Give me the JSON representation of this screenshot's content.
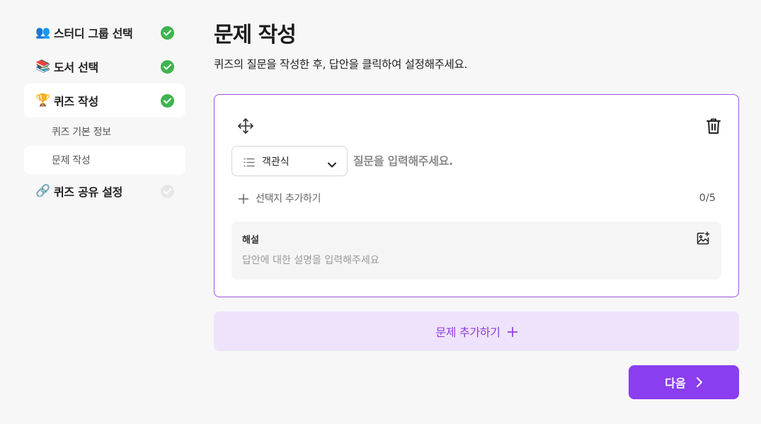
{
  "sidebar": {
    "steps": [
      {
        "emoji": "👥",
        "label": "스터디 그룹 선택",
        "done": true
      },
      {
        "emoji": "📚",
        "label": "도서 선택",
        "done": true
      },
      {
        "emoji": "🏆",
        "label": "퀴즈 작성",
        "done": true
      },
      {
        "emoji": "🔗",
        "label": "퀴즈 공유 설정",
        "done": false
      }
    ],
    "substeps": [
      {
        "label": "퀴즈 기본 정보"
      },
      {
        "label": "문제 작성"
      }
    ]
  },
  "main": {
    "title": "문제 작성",
    "description": "퀴즈의 질문을 작성한 후, 답안을 클릭하여 설정해주세요.",
    "question_card": {
      "type_select": {
        "value": "객관식",
        "icon": "list-icon"
      },
      "question_placeholder": "질문을 입력해주세요.",
      "add_choice_label": "선택지 추가하기",
      "choice_count": "0/5",
      "explanation": {
        "title": "해설",
        "placeholder": "답안에 대한 설명을 입력해주세요"
      }
    },
    "add_question_label": "문제 추가하기",
    "next_label": "다음"
  },
  "colors": {
    "accent": "#8a3ef0",
    "accent_light": "#efe3fb",
    "card_border": "#9d55e6",
    "done_green": "#3fb34f",
    "pending_gray": "#e6e6e6",
    "background": "#f7f7f7"
  }
}
